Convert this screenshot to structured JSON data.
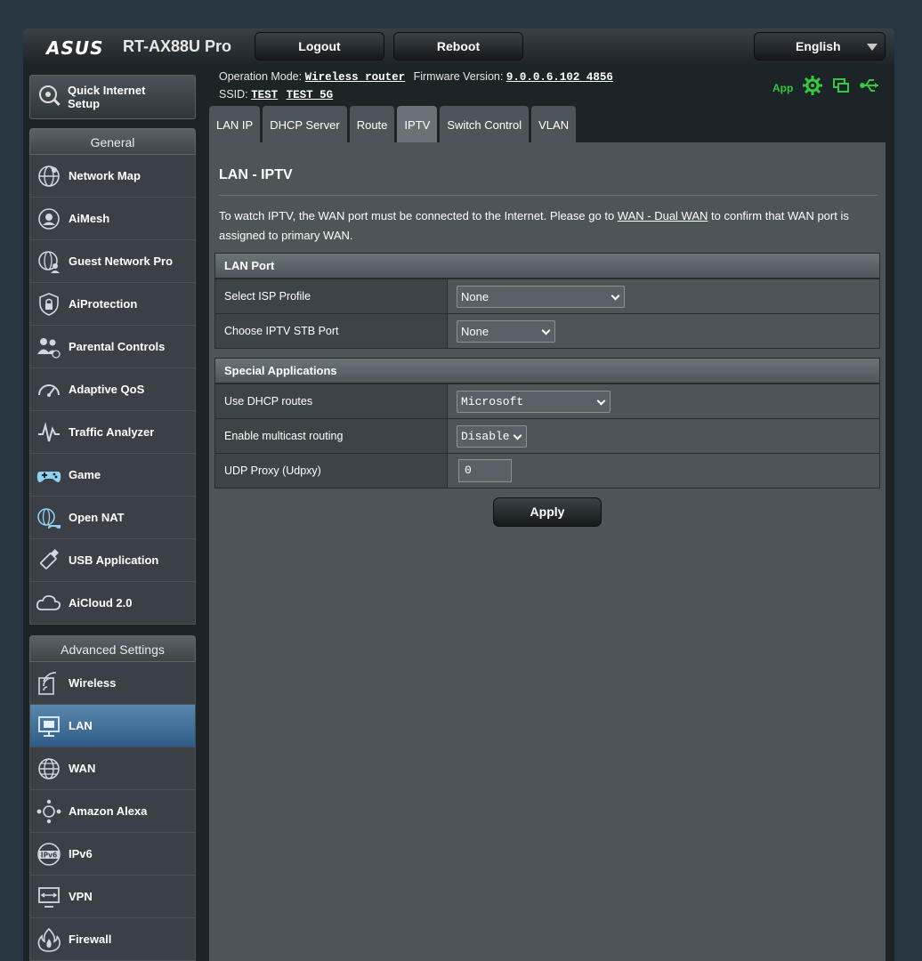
{
  "header": {
    "brand": "ASUS",
    "model": "RT-AX88U Pro",
    "logout_label": "Logout",
    "reboot_label": "Reboot",
    "language": "English",
    "operation_mode_label": "Operation Mode:",
    "operation_mode_value": "Wireless router",
    "firmware_label": "Firmware Version:",
    "firmware_value": "9.0.0.6.102_4856",
    "ssid_label": "SSID:",
    "ssid_1": "TEST",
    "ssid_2": "TEST_5G",
    "app_label": "App"
  },
  "sidebar": {
    "qis_label_line1": "Quick Internet",
    "qis_label_line2": "Setup",
    "general_title": "General",
    "general_items": [
      {
        "label": "Network Map",
        "icon": "globe-network-icon"
      },
      {
        "label": "AiMesh",
        "icon": "aimesh-icon"
      },
      {
        "label": "Guest Network Pro",
        "icon": "guest-network-icon"
      },
      {
        "label": "AiProtection",
        "icon": "shield-lock-icon"
      },
      {
        "label": "Parental Controls",
        "icon": "family-icon"
      },
      {
        "label": "Adaptive QoS",
        "icon": "speedometer-icon"
      },
      {
        "label": "Traffic Analyzer",
        "icon": "traffic-analyzer-icon"
      },
      {
        "label": "Game",
        "icon": "gamepad-icon"
      },
      {
        "label": "Open NAT",
        "icon": "open-nat-icon"
      },
      {
        "label": "USB Application",
        "icon": "usb-icon"
      },
      {
        "label": "AiCloud 2.0",
        "icon": "cloud-icon"
      }
    ],
    "advanced_title": "Advanced Settings",
    "advanced_items": [
      {
        "label": "Wireless",
        "icon": "wireless-icon"
      },
      {
        "label": "LAN",
        "icon": "lan-icon"
      },
      {
        "label": "WAN",
        "icon": "globe-icon"
      },
      {
        "label": "Amazon Alexa",
        "icon": "alexa-icon"
      },
      {
        "label": "IPv6",
        "icon": "ipv6-icon"
      },
      {
        "label": "VPN",
        "icon": "vpn-icon"
      },
      {
        "label": "Firewall",
        "icon": "firewall-icon"
      }
    ]
  },
  "tabs": [
    "LAN IP",
    "DHCP Server",
    "Route",
    "IPTV",
    "Switch Control",
    "VLAN"
  ],
  "main": {
    "title": "LAN - IPTV",
    "desc_before": "To watch IPTV, the WAN port must be connected to the Internet. Please go to ",
    "desc_link": "WAN - Dual WAN",
    "desc_after": " to confirm that WAN port is assigned to primary WAN.",
    "lan_port": {
      "title": "LAN Port",
      "isp_profile_label": "Select ISP Profile",
      "isp_profile_value": "None",
      "stb_port_label": "Choose IPTV STB Port",
      "stb_port_value": "None"
    },
    "special": {
      "title": "Special Applications",
      "dhcp_routes_label": "Use DHCP routes",
      "dhcp_routes_value": "Microsoft",
      "multicast_label": "Enable multicast routing",
      "multicast_value": "Disable",
      "udpxy_label": "UDP Proxy (Udpxy)",
      "udpxy_value": "0"
    },
    "apply_label": "Apply"
  },
  "colors": {
    "accent_green": "#36c93f",
    "active_menu": "#3f6f98"
  }
}
